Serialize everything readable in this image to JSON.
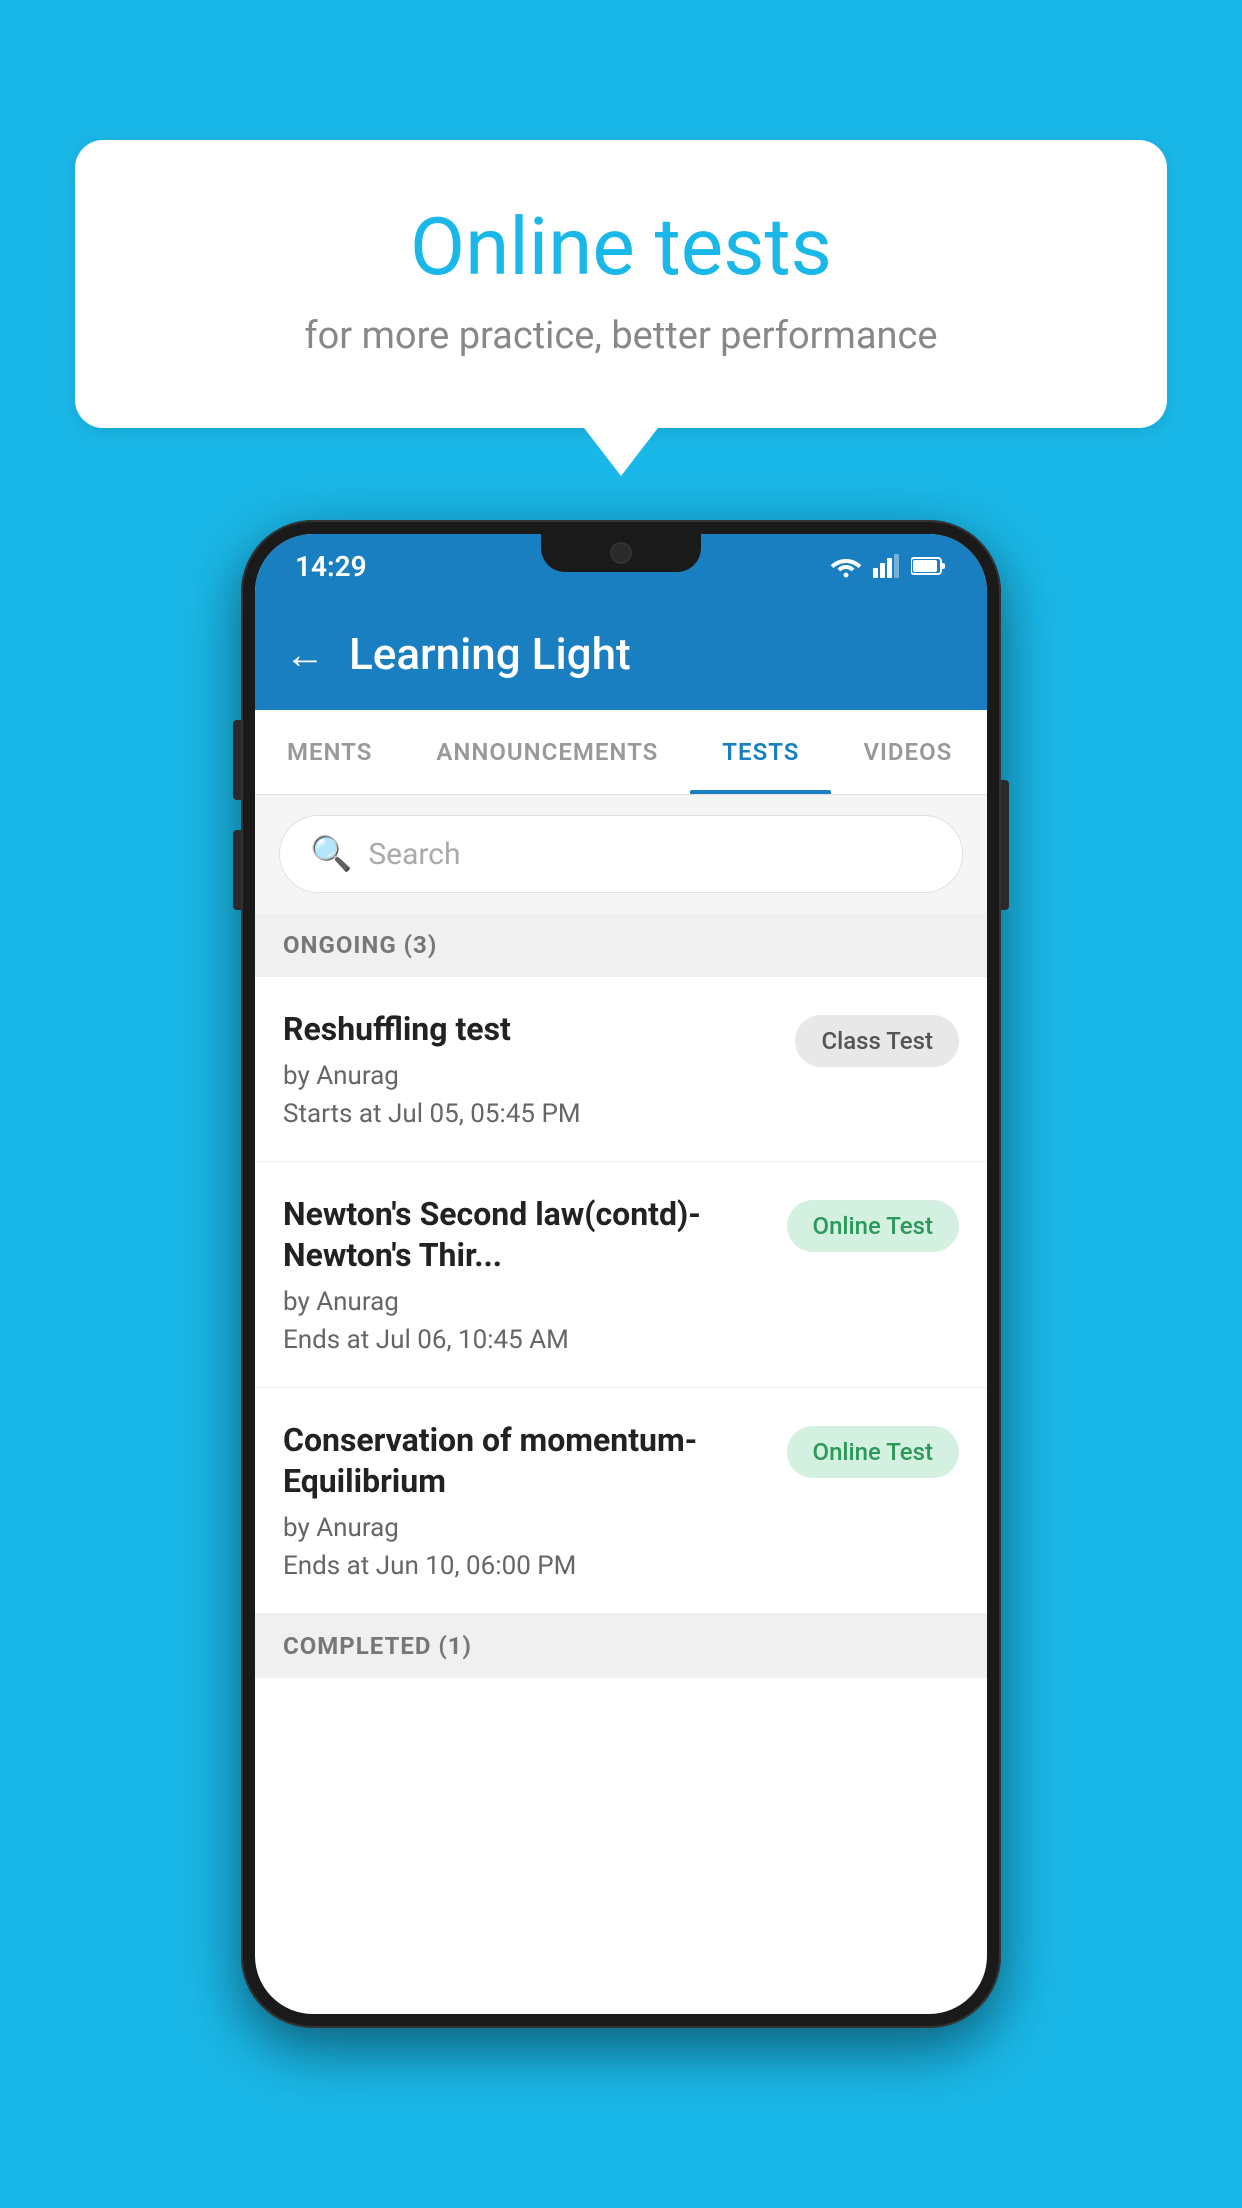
{
  "background_color": "#1ab8e8",
  "speech_bubble": {
    "title": "Online tests",
    "subtitle": "for more practice, better performance"
  },
  "phone": {
    "status_bar": {
      "time": "14:29",
      "icons": [
        "wifi",
        "signal",
        "battery"
      ]
    },
    "app_bar": {
      "title": "Learning Light",
      "back_label": "←"
    },
    "tabs": [
      {
        "label": "MENTS",
        "active": false
      },
      {
        "label": "ANNOUNCEMENTS",
        "active": false
      },
      {
        "label": "TESTS",
        "active": true
      },
      {
        "label": "VIDEOS",
        "active": false
      }
    ],
    "search": {
      "placeholder": "Search"
    },
    "sections": [
      {
        "header": "ONGOING (3)",
        "items": [
          {
            "title": "Reshuffling test",
            "author": "by Anurag",
            "time_label": "Starts at",
            "time_value": "Jul 05, 05:45 PM",
            "badge": "Class Test",
            "badge_type": "class"
          },
          {
            "title": "Newton's Second law(contd)-Newton's Thir...",
            "author": "by Anurag",
            "time_label": "Ends at",
            "time_value": "Jul 06, 10:45 AM",
            "badge": "Online Test",
            "badge_type": "online"
          },
          {
            "title": "Conservation of momentum-Equilibrium",
            "author": "by Anurag",
            "time_label": "Ends at",
            "time_value": "Jun 10, 06:00 PM",
            "badge": "Online Test",
            "badge_type": "online"
          }
        ]
      },
      {
        "header": "COMPLETED (1)",
        "items": []
      }
    ]
  }
}
